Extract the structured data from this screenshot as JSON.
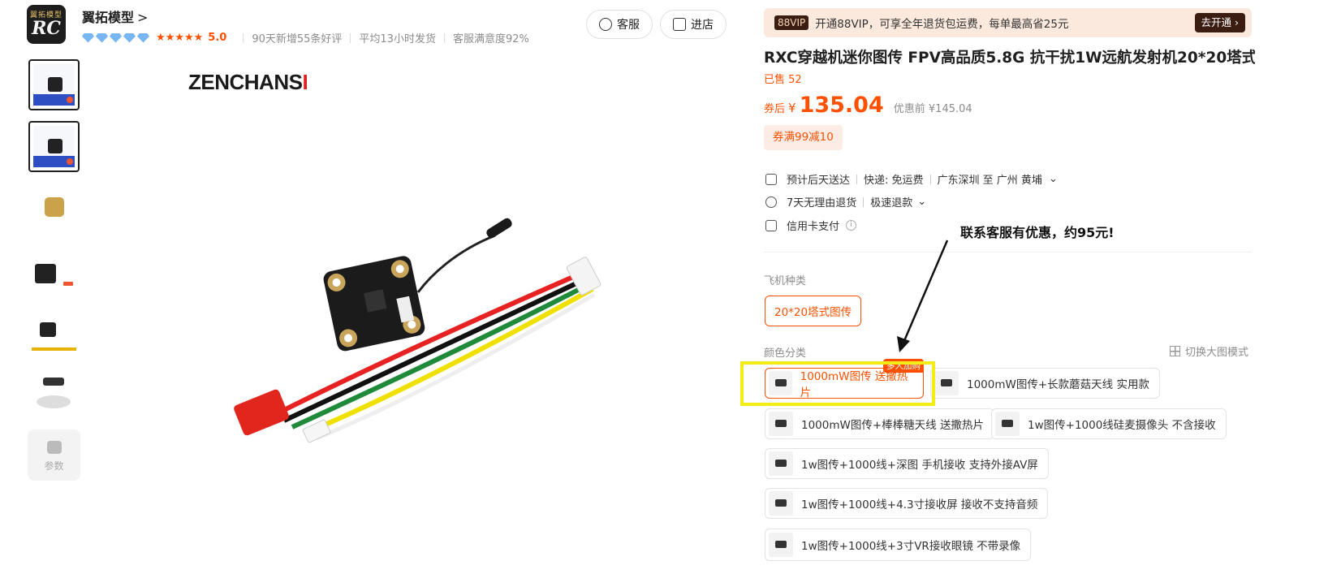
{
  "shop": {
    "logo_top": "翼拓模型",
    "logo_bottom": "RC",
    "name": "翼拓模型",
    "chevron": ">",
    "stars": "★★★★★",
    "score": "5.0",
    "stats": [
      "90天新增55条好评",
      "平均13小时发货",
      "客服满意度92%"
    ]
  },
  "header_buttons": {
    "service": "客服",
    "store": "进店"
  },
  "gallery": {
    "brand_prefix": "ZENCHANS",
    "brand_accent": "I",
    "params_label": "参数",
    "thumbnail_count": 6
  },
  "vip": {
    "tag": "88VIP",
    "text": "开通88VIP，可享全年退货包运费，每单最高省25元",
    "cta": "去开通 ›"
  },
  "product": {
    "title": "RXC穿越机迷你图传 FPV高品质5.8G 抗干扰1W远航发射机20*20塔式",
    "sold": "已售 52",
    "price_label": "券后",
    "currency": "¥",
    "price": "135.04",
    "original_price": "优惠前 ¥145.04",
    "coupon": "券满99减10"
  },
  "delivery": {
    "arrival": "预计后天送达",
    "shipping": "快递: 免运费",
    "route": "广东深圳 至 广州 黄埔",
    "returns": "7天无理由退货",
    "refund": "极速退款",
    "payment": "信用卡支付",
    "payment_info": "i"
  },
  "aircraft_type": {
    "label": "飞机种类",
    "options": [
      "20*20塔式图传"
    ]
  },
  "color": {
    "label": "颜色分类",
    "toggle": "切换大图模式",
    "badge": "多人加购",
    "options": [
      "1000mW图传 送撒热片",
      "1000mW图传+长款蘑菇天线 实用款",
      "1000mW图传+棒棒糖天线 送撒热片",
      "1w图传+1000线硅麦摄像头 不含接收",
      "1w图传+1000线+深图 手机接收 支持外接AV屏",
      "1w图传+1000线+4.3寸接收屏 接收不支持音频",
      "1w图传+1000线+3寸VR接收眼镜 不带录像"
    ]
  },
  "annotation": {
    "note": "联系客服有优惠，约95元!",
    "highlight_color": "#f3ec16",
    "accent": "#ff5000"
  }
}
